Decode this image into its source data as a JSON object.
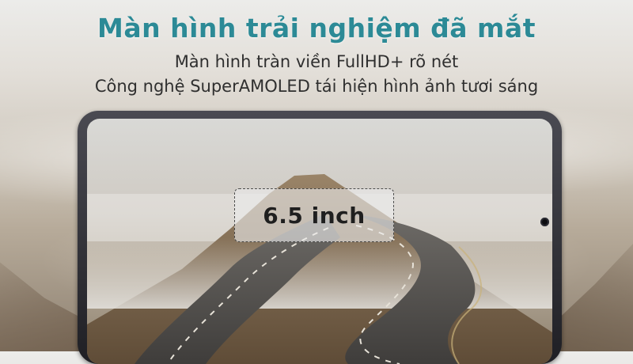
{
  "banner": {
    "headline": "Màn hình trải nghiệm đã mắt",
    "subline_1": "Màn hình tràn viền FullHD+ rõ nét",
    "subline_2": "Công nghệ SuperAMOLED tái hiện hình ảnh tươi sáng",
    "headline_color": "#2c8a96"
  },
  "phone": {
    "screen_size_label": "6.5 inch",
    "scene": "foggy mountain road"
  }
}
